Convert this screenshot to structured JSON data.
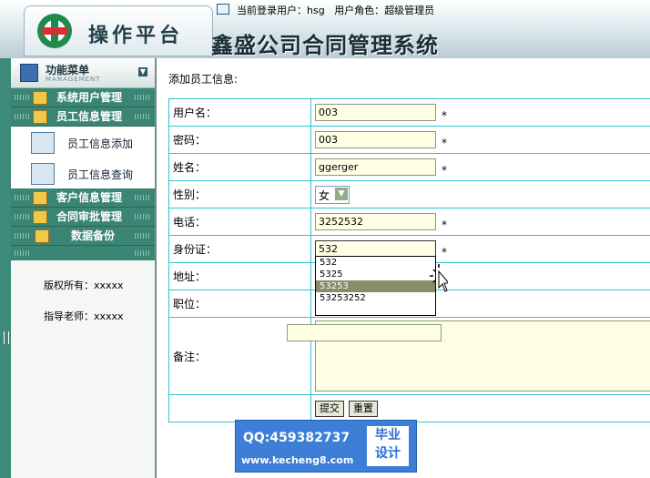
{
  "header": {
    "platform_title": "操作平台",
    "system_title": "鑫盛公司合同管理系统",
    "login_label": "当前登录用户：",
    "login_user": "hsg",
    "role_label": "用户角色：",
    "role_value": "超级管理员"
  },
  "sidebar": {
    "menu_title": "功能菜单",
    "menu_sub": "MANAGEMENT",
    "sections": [
      {
        "label": "系统用户管理"
      },
      {
        "label": "员工信息管理"
      },
      {
        "label": "客户信息管理"
      },
      {
        "label": "合同审批管理"
      },
      {
        "label": "数据备份"
      }
    ],
    "sub_items": [
      {
        "label": "员工信息添加"
      },
      {
        "label": "员工信息查询"
      }
    ],
    "copyright": "版权所有：xxxxx",
    "advisor": "指导老师：xxxxx"
  },
  "form": {
    "title": "添加员工信息:",
    "rows": [
      {
        "label": "用户名：",
        "value": "003",
        "required": "*"
      },
      {
        "label": "密码：",
        "value": "003",
        "required": "*"
      },
      {
        "label": "姓名：",
        "value": "ggerger",
        "required": "*"
      },
      {
        "label": "性别：",
        "value": "女"
      },
      {
        "label": "电话：",
        "value": "3252532",
        "required": "*"
      },
      {
        "label": "身份证：",
        "value": "532",
        "required": "*"
      },
      {
        "label": "地址：",
        "value": ""
      },
      {
        "label": "职位：",
        "value": ""
      },
      {
        "label": "备注：",
        "value": ""
      }
    ],
    "submit": "提交",
    "reset": "重置"
  },
  "autocomplete": {
    "options": [
      "532",
      "5325",
      "53253",
      "53253252"
    ],
    "highlighted_index": 2
  },
  "watermark": {
    "qq": "QQ:459382737",
    "site": "www.kecheng8.com",
    "badge_line1": "毕业",
    "badge_line2": "设计"
  },
  "colors": {
    "sidebar_section": "#3b8575",
    "table_border": "#33c0d0",
    "input_bg": "#ffffe6"
  }
}
